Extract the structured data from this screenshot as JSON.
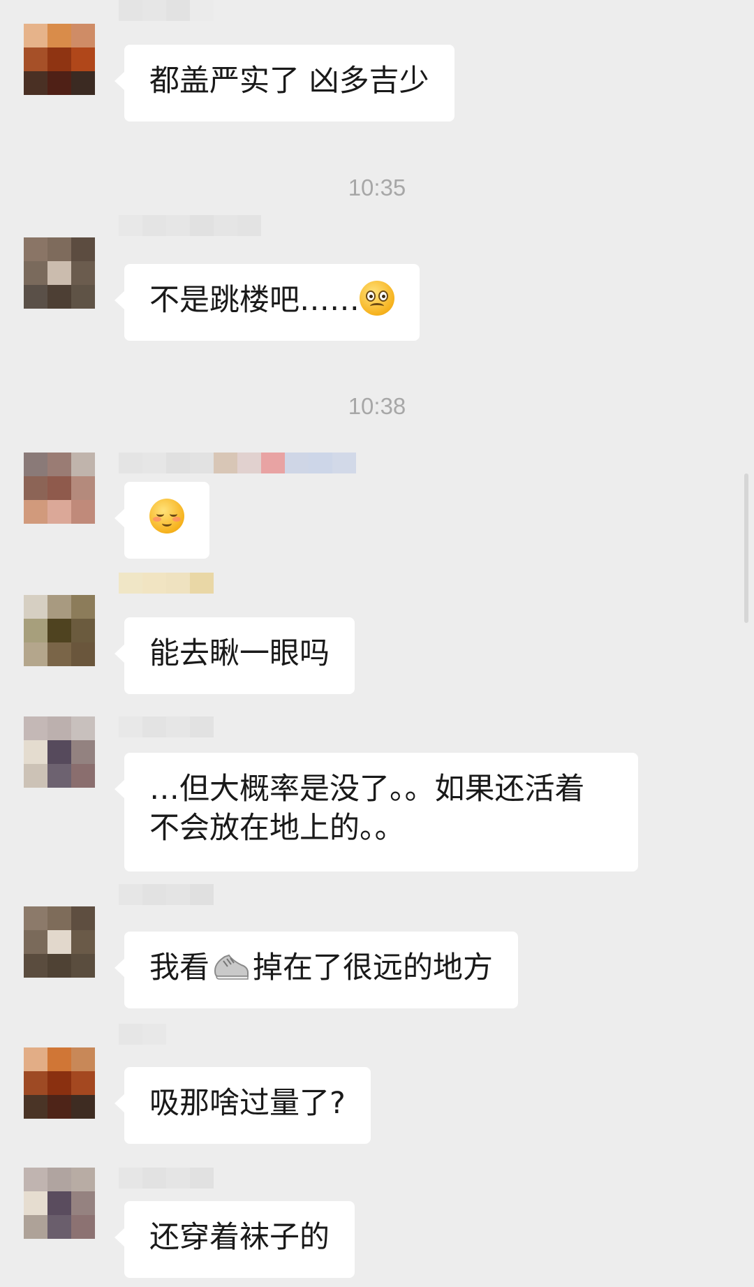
{
  "timestamps": [
    "10:35",
    "10:38"
  ],
  "messages": [
    {
      "text": "都盖严实了 凶多吉少"
    },
    {
      "text": "不是跳楼吧……",
      "emoji": "pleading-face"
    },
    {
      "emoji": "blushing-smile-face"
    },
    {
      "text": "能去瞅一眼吗"
    },
    {
      "line1": "…但大概率是没了。。如果还活着",
      "line2": "不会放在地上的。。"
    },
    {
      "before": "我看",
      "emoji": "sneaker",
      "after": "掉在了很远的地方"
    },
    {
      "text": "吸那啥过量了?"
    },
    {
      "text": "还穿着袜子的"
    }
  ]
}
